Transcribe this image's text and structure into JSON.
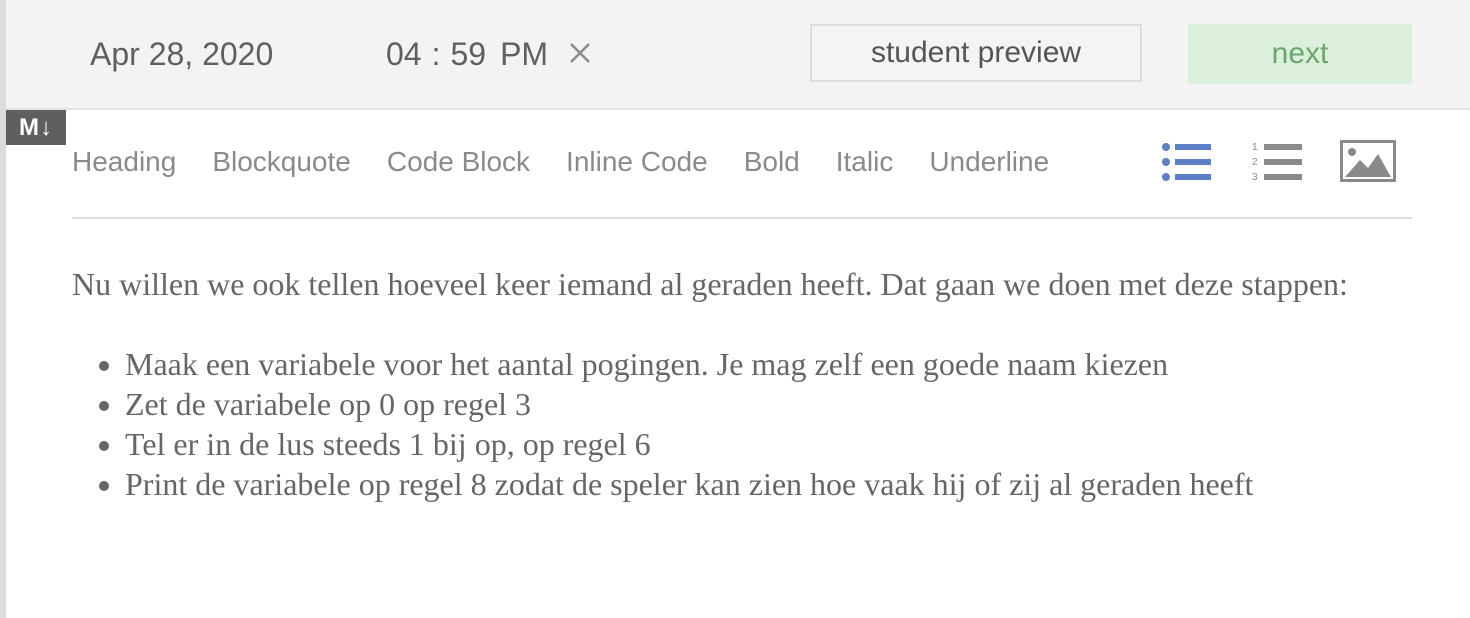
{
  "header": {
    "date": "Apr 28, 2020",
    "time_hours": "04",
    "time_separator": ":",
    "time_minutes": "59",
    "time_ampm": "PM",
    "preview_label": "student preview",
    "next_label": "next"
  },
  "badge": {
    "label": "M↓"
  },
  "toolbar": {
    "items": [
      {
        "label": "Heading"
      },
      {
        "label": "Blockquote"
      },
      {
        "label": "Code Block"
      },
      {
        "label": "Inline Code"
      },
      {
        "label": "Bold"
      },
      {
        "label": "Italic"
      },
      {
        "label": "Underline"
      }
    ],
    "icons": [
      "bulleted-list-icon",
      "numbered-list-icon",
      "image-icon"
    ],
    "numbered_list_digits": [
      "1",
      "2",
      "3"
    ],
    "accent_color": "#5b80c6"
  },
  "content": {
    "intro": "Nu willen we ook tellen hoeveel keer iemand al geraden heeft. Dat gaan we doen met deze stappen:",
    "bullets": [
      "Maak een variabele voor het aantal pogingen. Je mag zelf een goede naam kiezen",
      "Zet de variabele op 0 op regel 3",
      "Tel er in de lus steeds 1 bij op, op regel 6",
      "Print de variabele op regel 8 zodat de speler kan zien hoe vaak hij of zij al geraden heeft"
    ]
  }
}
